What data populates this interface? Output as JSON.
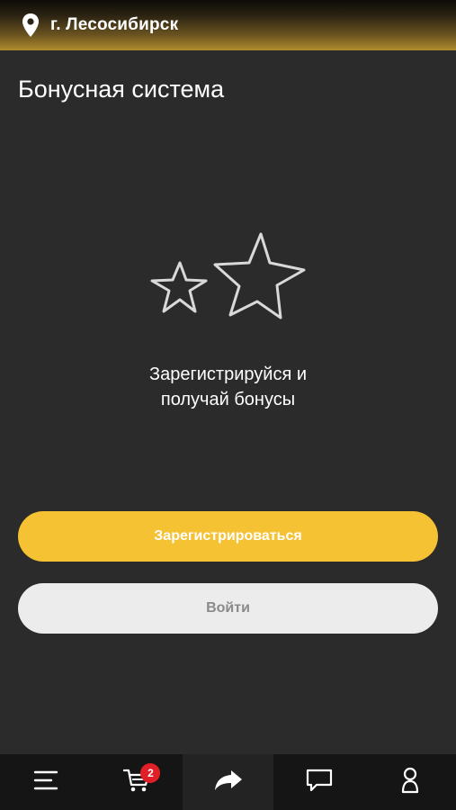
{
  "header": {
    "city": "г. Лесосибирск",
    "location_icon": "location-pin-icon"
  },
  "page": {
    "title": "Бонусная система",
    "illustration_icon": "stars-icon",
    "promo_line1": "Зарегистрируйся и",
    "promo_line2": "получай бонусы"
  },
  "actions": {
    "register_label": "Зарегистрироваться",
    "login_label": "Войти"
  },
  "bottom_nav": {
    "items": [
      {
        "icon": "menu-icon"
      },
      {
        "icon": "cart-icon",
        "badge": "2"
      },
      {
        "icon": "share-icon",
        "active": true
      },
      {
        "icon": "chat-icon"
      },
      {
        "icon": "profile-icon"
      }
    ]
  },
  "colors": {
    "background": "#2b2b2b",
    "accent": "#f5c234",
    "badge": "#e01f26",
    "secondary_button": "#ececec"
  }
}
